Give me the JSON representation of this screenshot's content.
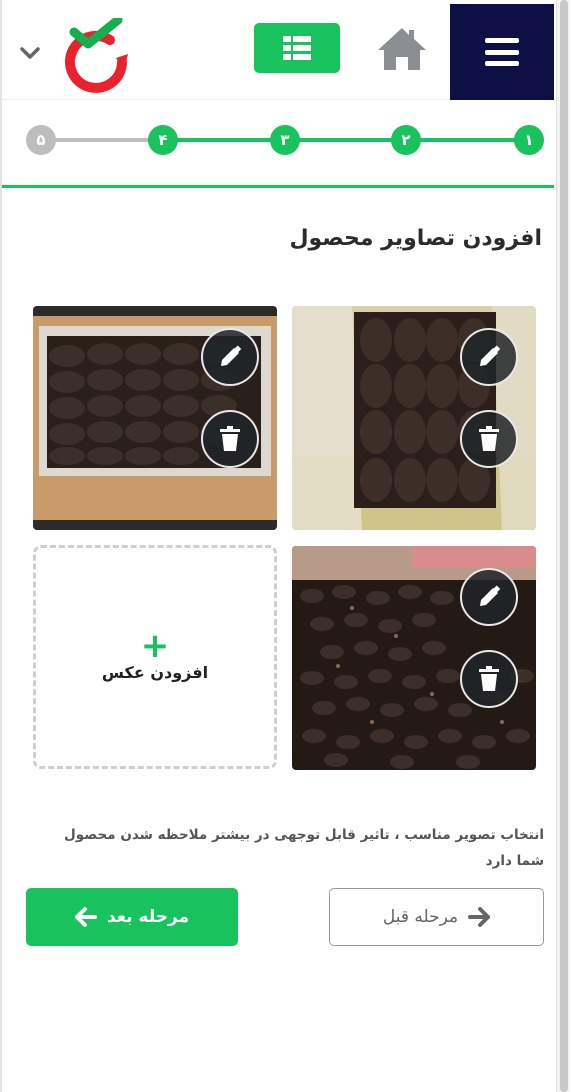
{
  "header": {
    "menu_icon": "hamburger-menu-icon",
    "home_icon": "home-icon",
    "grid_icon": "list-grid-icon",
    "logo_icon": "brand-logo-checkmark",
    "dropdown_icon": "chevron-down-icon",
    "accent_color": "#18c25d",
    "menu_bg_color": "#0d0f45"
  },
  "stepper": {
    "steps": [
      {
        "label": "۱",
        "state": "done"
      },
      {
        "label": "۲",
        "state": "done"
      },
      {
        "label": "۳",
        "state": "done"
      },
      {
        "label": "۴",
        "state": "done"
      },
      {
        "label": "۵",
        "state": "todo"
      }
    ]
  },
  "page": {
    "title": "افزودن تصاویر محصول"
  },
  "photos": {
    "edit_icon": "pencil-icon",
    "delete_icon": "trash-icon",
    "count": 3
  },
  "add_photo": {
    "plus": "+",
    "label": "افزودن عکس"
  },
  "hint": "انتخاب تصویر مناسب ، تاثیر قابل توجهی در بیشتر ملاحظه شدن محصول شما دارد",
  "buttons": {
    "next_label": "مرحله بعد",
    "prev_label": "مرحله قبل"
  }
}
